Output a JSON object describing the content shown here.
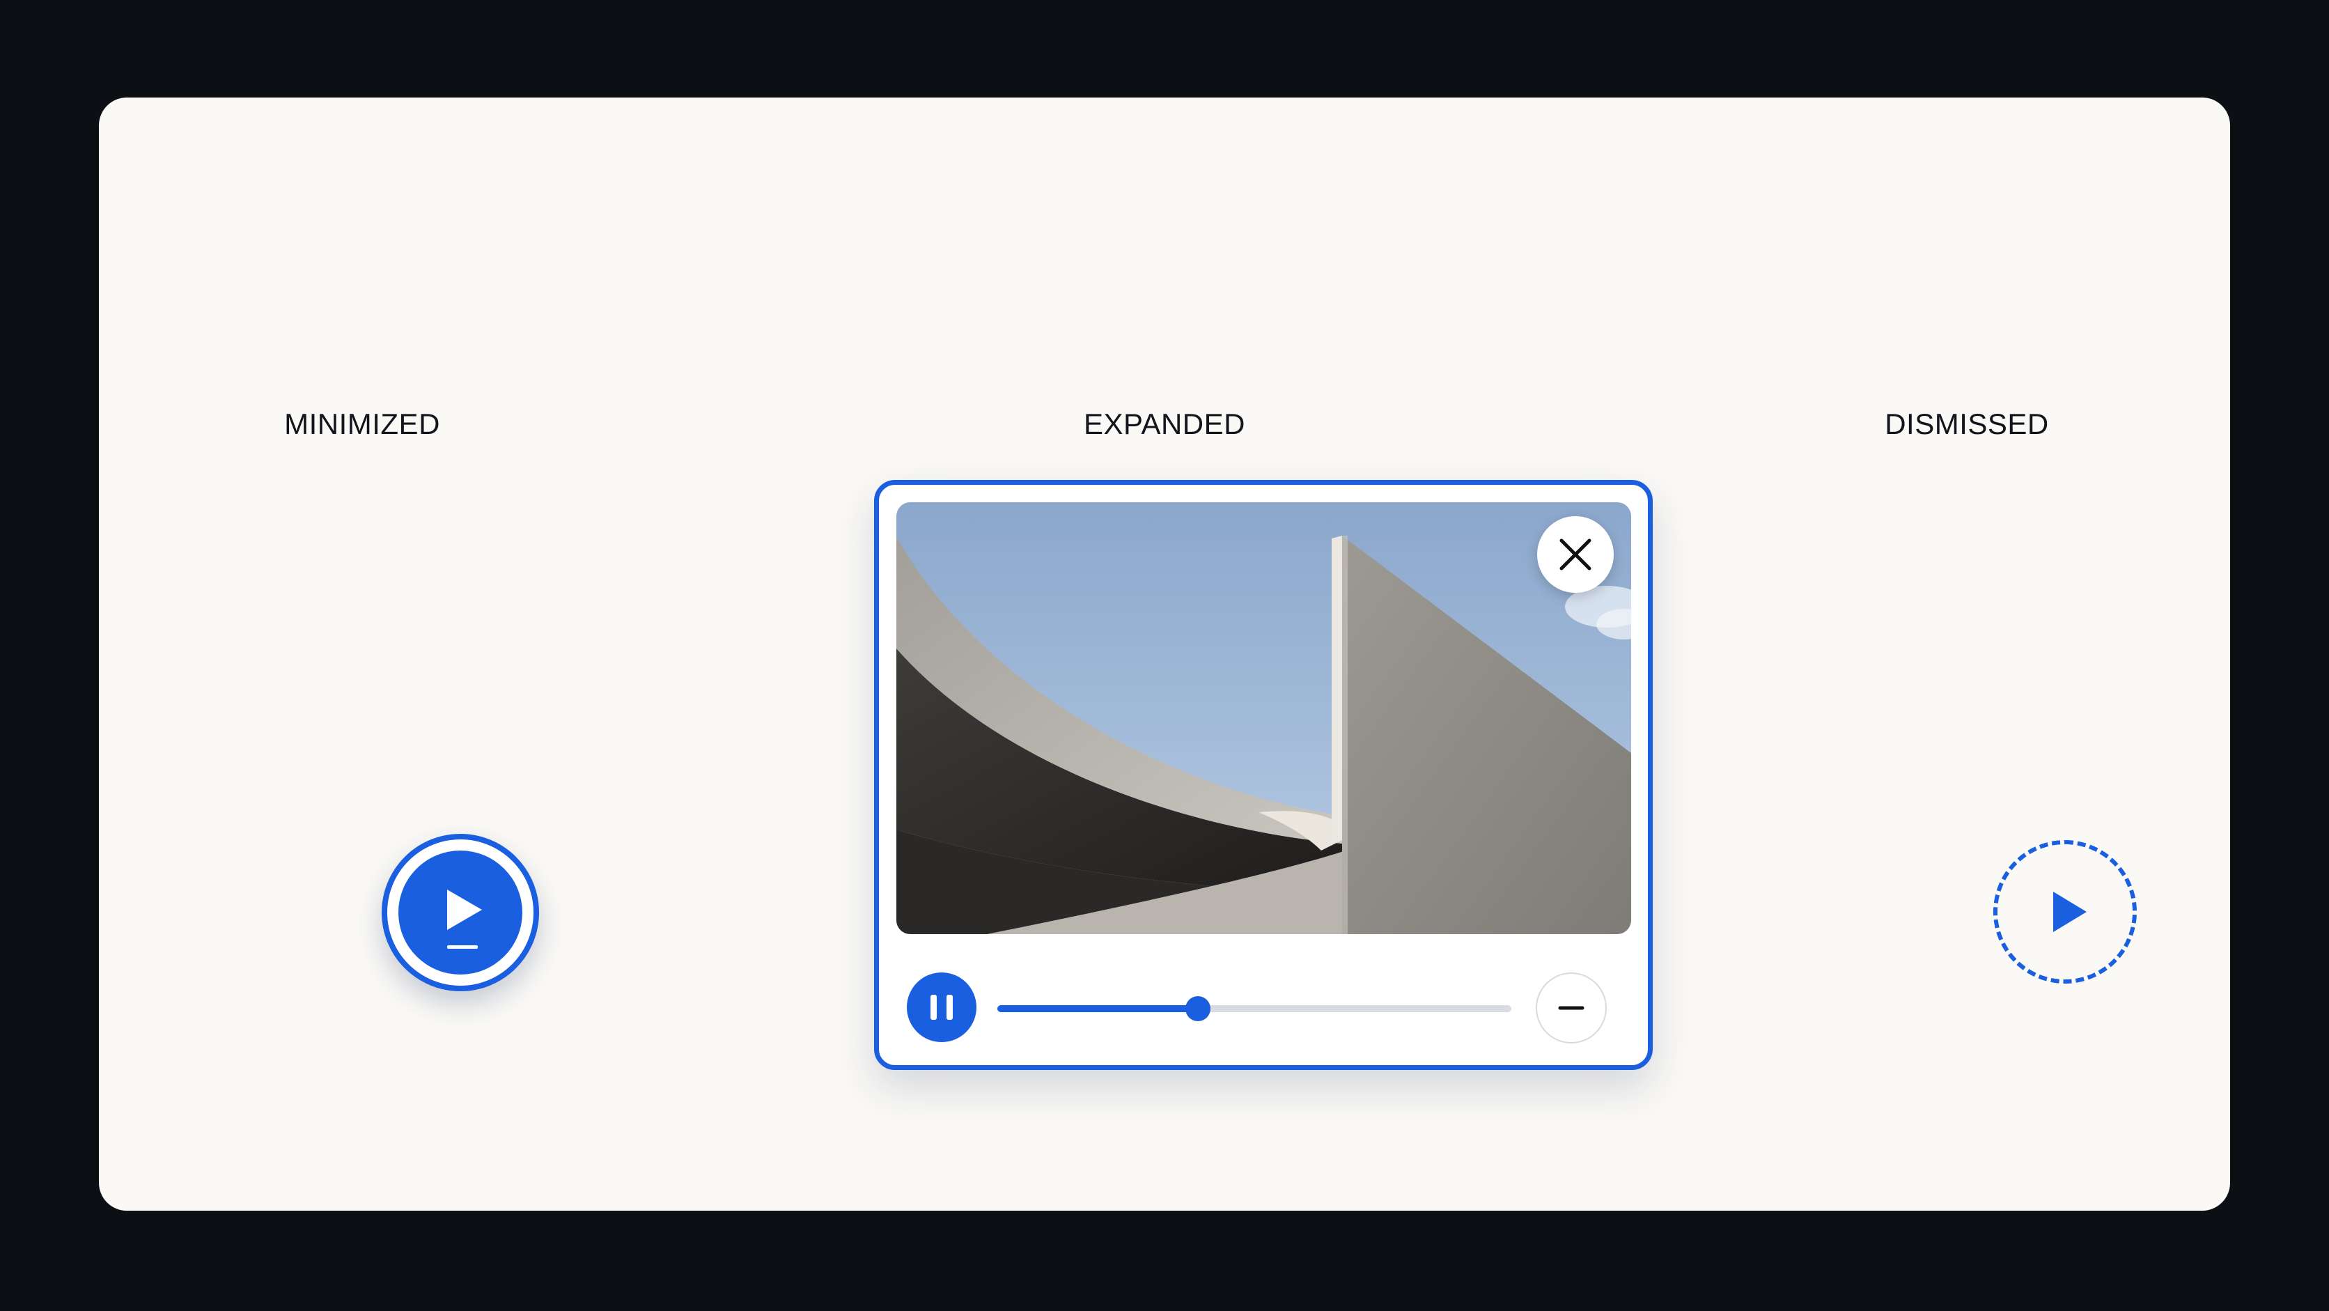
{
  "labels": {
    "minimized": "MINIMIZED",
    "expanded": "EXPANDED",
    "dismissed": "DISMISSED"
  },
  "player": {
    "progress": 0.39,
    "video_description_icon": "concrete-architecture-thumbnail"
  },
  "icons": {
    "minimized": "play-icon",
    "close": "close-icon",
    "pause": "pause-icon",
    "minimize": "minus-icon",
    "dismissed": "play-icon"
  },
  "colors": {
    "accent": "#1a5fe0",
    "card": "#faf9f6",
    "background": "#0c0f14",
    "track": "#d8dbe1"
  }
}
